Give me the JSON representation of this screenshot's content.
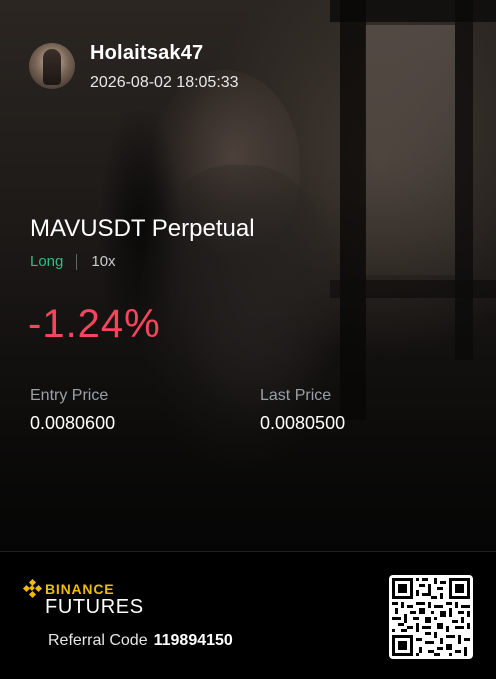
{
  "user": {
    "username": "Holaitsak47",
    "timestamp": "2026-08-02 18:05:33"
  },
  "position": {
    "symbol_title": "MAVUSDT Perpetual",
    "side": "Long",
    "leverage": "10x",
    "pnl_percent": "-1.24%",
    "entry_price_label": "Entry Price",
    "entry_price": "0.0080600",
    "last_price_label": "Last Price",
    "last_price": "0.0080500"
  },
  "footer": {
    "brand_top": "BINANCE",
    "brand_bottom": "FUTURES",
    "referral_label": "Referral Code",
    "referral_code": "119894150"
  },
  "colors": {
    "long_green": "#2ebd85",
    "loss_red": "#f6465d",
    "binance_yellow": "#f0b90b",
    "background": "#000000"
  },
  "icons": {
    "logo": "binance-logo-icon",
    "qr": "referral-qr-code"
  }
}
